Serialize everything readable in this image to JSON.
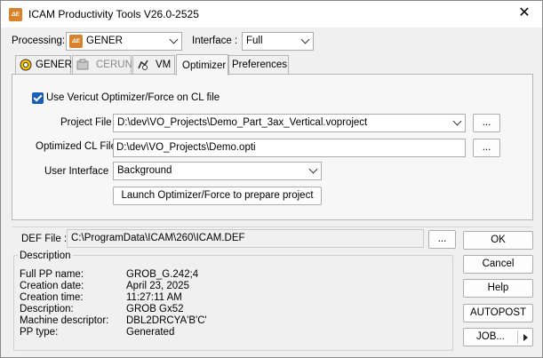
{
  "window": {
    "title": "ICAM Productivity Tools V26.0-2525",
    "app_icon_text": "ΔE"
  },
  "processing": {
    "label": "Processing:",
    "value": "GENER",
    "icon_text": "ΔE"
  },
  "interface": {
    "label": "Interface :",
    "value": "Full"
  },
  "tabs": [
    {
      "label": "GENER",
      "active": false,
      "disabled": false
    },
    {
      "label": "CERUN",
      "active": false,
      "disabled": true
    },
    {
      "label": "VM",
      "active": false,
      "disabled": false
    },
    {
      "label": "Optimizer",
      "active": true,
      "disabled": false
    },
    {
      "label": "Preferences",
      "active": false,
      "disabled": false
    }
  ],
  "optimizer": {
    "checkbox_label": "Use Vericut Optimizer/Force on CL file",
    "project_file_label": "Project File",
    "project_file_value": "D:\\dev\\VO_Projects\\Demo_Part_3ax_Vertical.voproject",
    "optimized_cl_label": "Optimized CL File",
    "optimized_cl_value": "D:\\dev\\VO_Projects\\Demo.opti",
    "browse_label": "...",
    "user_interface_label": "User Interface",
    "user_interface_value": "Background",
    "launch_label": "Launch Optimizer/Force to prepare project"
  },
  "def_file": {
    "label": "DEF File :",
    "value": "C:\\ProgramData\\ICAM\\260\\ICAM.DEF",
    "browse_label": "..."
  },
  "description": {
    "title": "Description",
    "rows": [
      {
        "key": "Full PP name:",
        "value": "GROB_G.242;4"
      },
      {
        "key": "Creation date:",
        "value": "April 23, 2025"
      },
      {
        "key": "Creation time:",
        "value": "11:27:11 AM"
      },
      {
        "key": "Description:",
        "value": "GROB Gx52"
      },
      {
        "key": "Machine descriptor:",
        "value": "DBL2DRCYA'B'C'"
      },
      {
        "key": "PP type:",
        "value": "Generated"
      }
    ]
  },
  "buttons": {
    "ok": "OK",
    "cancel": "Cancel",
    "help": "Help",
    "autopost": "AUTOPOST",
    "job": "JOB..."
  },
  "colors": {
    "accent": "#1a5fb4",
    "icam_orange": "#d9822b",
    "window_bg": "#f0f0f0"
  }
}
